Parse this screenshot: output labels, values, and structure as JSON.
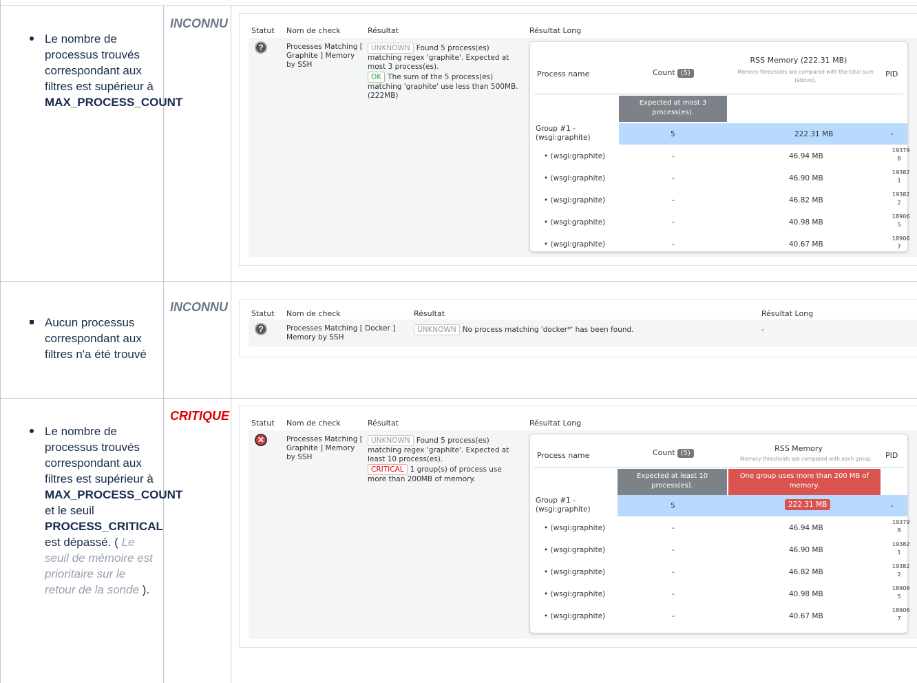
{
  "headers": {
    "statut": "Statut",
    "nom": "Nom de check",
    "resultat": "Résultat",
    "resultat_long": "Résultat Long"
  },
  "rows": [
    {
      "status": "INCONNU",
      "desc_parts": [
        "Le nombre de processus trouvés correspondant aux filtres est supérieur à ",
        "MAX_PROCESS_COUNT"
      ],
      "check_name": "Processes Matching [ Graphite ] Memory by SSH",
      "result_lines": [
        {
          "tag": "UNKNOWN",
          "text": "Found 5 process(es) matching regex 'graphite'. Expected at most 3 process(es)."
        },
        {
          "tag": "OK",
          "text": "The sum of the 5 process(es) matching 'graphite' use less than 500MB. (222MB)"
        }
      ],
      "long": {
        "col_process": "Process name",
        "col_count": "Count",
        "count_badge": "(5)",
        "col_rss": "RSS Memory (222.31 MB)",
        "col_rss_sub": "Memory thresholds are compared with the total sum (above).",
        "col_pid": "PID",
        "count_box": "Expected at most 3 process(es).",
        "group_label": "Group #1 - (wsgi:graphite)",
        "group_count": "5",
        "group_rss": "222.31 MB",
        "group_pid": "-",
        "procs": [
          {
            "name": "(wsgi:graphite)",
            "count": "-",
            "rss": "46.94 MB",
            "pid": "193798"
          },
          {
            "name": "(wsgi:graphite)",
            "count": "-",
            "rss": "46.90 MB",
            "pid": "193821"
          },
          {
            "name": "(wsgi:graphite)",
            "count": "-",
            "rss": "46.82 MB",
            "pid": "193822"
          },
          {
            "name": "(wsgi:graphite)",
            "count": "-",
            "rss": "40.98 MB",
            "pid": "189065"
          },
          {
            "name": "(wsgi:graphite)",
            "count": "-",
            "rss": "40.67 MB",
            "pid": "189067"
          }
        ]
      }
    },
    {
      "status": "INCONNU",
      "desc": "Aucun processus correspondant aux filtres n'a été trouvé",
      "check_name": "Processes Matching [ Docker ] Memory by SSH",
      "result_tag": "UNKNOWN",
      "result_text": "No process matching 'docker*' has been found.",
      "long_text": "-"
    },
    {
      "status": "CRITIQUE",
      "desc_parts": [
        "Le nombre de processus trouvés correspondant aux filtres est supérieur à ",
        "MAX_PROCESS_COUNT",
        " et le seuil ",
        "PROCESS_CRITICAL",
        " est dépassé. ( ",
        "Le seuil de mémoire est prioritaire sur le retour de la sonde",
        " )."
      ],
      "check_name": "Processes Matching [ Graphite ] Memory by SSH",
      "result_lines": [
        {
          "tag": "UNKNOWN",
          "text": "Found 5 process(es) matching regex 'graphite'. Expected at least 10 process(es)."
        },
        {
          "tag": "CRITICAL",
          "text": "1 group(s) of process use more than 200MB of memory."
        }
      ],
      "long": {
        "col_process": "Process name",
        "col_count": "Count",
        "count_badge": "(5)",
        "col_rss": "RSS Memory",
        "col_rss_sub": "Memory thresholds are compared with each group.",
        "col_pid": "PID",
        "count_box": "Expected at least 10 process(es).",
        "rss_box": "One group uses more than 200 MB of memory.",
        "group_label": "Group #1 - (wsgi:graphite)",
        "group_count": "5",
        "group_rss": "222.31 MB",
        "group_pid": "-",
        "procs": [
          {
            "name": "(wsgi:graphite)",
            "count": "-",
            "rss": "46.94 MB",
            "pid": "193798"
          },
          {
            "name": "(wsgi:graphite)",
            "count": "-",
            "rss": "46.90 MB",
            "pid": "193821"
          },
          {
            "name": "(wsgi:graphite)",
            "count": "-",
            "rss": "46.82 MB",
            "pid": "193822"
          },
          {
            "name": "(wsgi:graphite)",
            "count": "-",
            "rss": "40.98 MB",
            "pid": "189065"
          },
          {
            "name": "(wsgi:graphite)",
            "count": "-",
            "rss": "40.67 MB",
            "pid": "189067"
          }
        ]
      }
    }
  ]
}
